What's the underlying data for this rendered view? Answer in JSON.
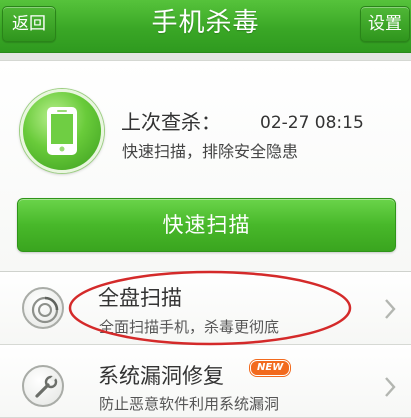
{
  "header": {
    "back_label": "返回",
    "title": "手机杀毒",
    "settings_label": "设置"
  },
  "status": {
    "last_scan_label": "上次查杀：",
    "last_scan_time": "02-27 08:15",
    "subtitle": "快速扫描，排除安全隐患",
    "icon": "phone-icon"
  },
  "quick_scan_label": "快速扫描",
  "list": [
    {
      "title": "全盘扫描",
      "subtitle": "全面扫描手机，杀毒更彻底",
      "icon": "disk-scan-icon",
      "annotation": "highlight-oval"
    },
    {
      "title": "系统漏洞修复",
      "subtitle": "防止恶意软件利用系统漏洞",
      "badge": "NEW",
      "icon": "wrench-icon"
    }
  ],
  "colors": {
    "brand_green": "#3aa726",
    "annotation_red": "#d42a2a",
    "badge_orange": "#f26a1e"
  }
}
